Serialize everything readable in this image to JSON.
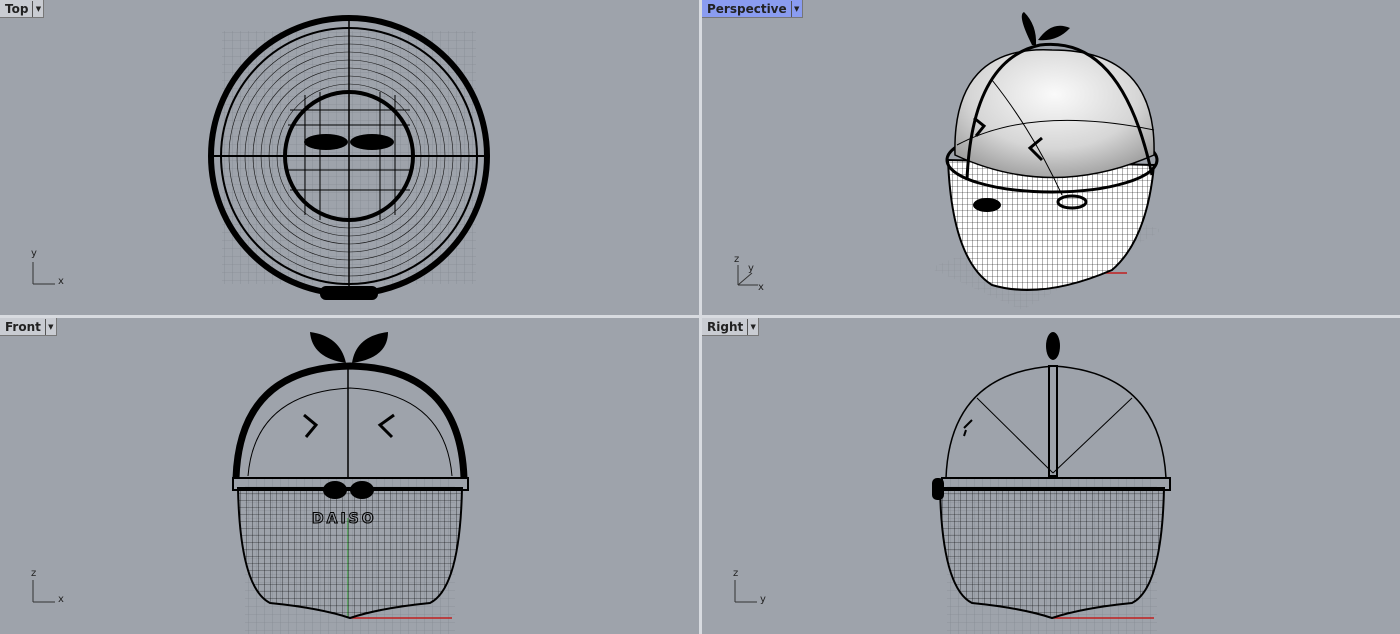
{
  "viewports": [
    {
      "name": "Top",
      "active": false,
      "axes": [
        "y",
        "x"
      ]
    },
    {
      "name": "Perspective",
      "active": true,
      "axes": [
        "z",
        "y",
        "x"
      ]
    },
    {
      "name": "Front",
      "active": false,
      "axes": [
        "z",
        "x"
      ]
    },
    {
      "name": "Right",
      "active": false,
      "axes": [
        "z",
        "y"
      ]
    }
  ],
  "colors": {
    "viewport_bg": "#9ea3ab",
    "active_tab": "#8a9cf0",
    "x_axis": "#c02020",
    "y_axis": "#20a020"
  }
}
